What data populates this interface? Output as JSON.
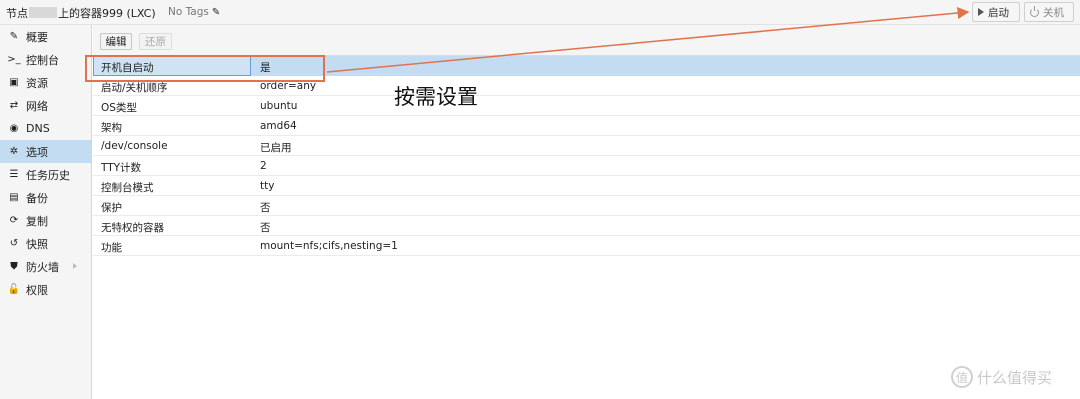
{
  "header": {
    "title_prefix": "节点",
    "title_suffix": "上的容器999 (LXC)",
    "tags_label": "No Tags",
    "start_label": "启动",
    "shutdown_label": "关机"
  },
  "sidebar": {
    "items": [
      {
        "label": "概要",
        "icon": "✎"
      },
      {
        "label": "控制台",
        "icon": ">_"
      },
      {
        "label": "资源",
        "icon": "▣"
      },
      {
        "label": "网络",
        "icon": "⇄"
      },
      {
        "label": "DNS",
        "icon": "◉"
      },
      {
        "label": "选项",
        "icon": "✲"
      },
      {
        "label": "任务历史",
        "icon": "☰"
      },
      {
        "label": "备份",
        "icon": "▤"
      },
      {
        "label": "复制",
        "icon": "⟳"
      },
      {
        "label": "快照",
        "icon": "↺"
      },
      {
        "label": "防火墙",
        "icon": "⛊"
      },
      {
        "label": "权限",
        "icon": "🔓"
      }
    ]
  },
  "toolbar": {
    "edit_label": "编辑",
    "revert_label": "还原"
  },
  "options": {
    "rows": [
      {
        "key": "开机自启动",
        "value": "是"
      },
      {
        "key": "启动/关机顺序",
        "value": "order=any"
      },
      {
        "key": "OS类型",
        "value": "ubuntu"
      },
      {
        "key": "架构",
        "value": "amd64"
      },
      {
        "key": "/dev/console",
        "value": "已启用"
      },
      {
        "key": "TTY计数",
        "value": "2"
      },
      {
        "key": "控制台模式",
        "value": "tty"
      },
      {
        "key": "保护",
        "value": "否"
      },
      {
        "key": "无特权的容器",
        "value": "否"
      },
      {
        "key": "功能",
        "value": "mount=nfs;cifs,nesting=1"
      }
    ]
  },
  "annotation": {
    "note": "按需设置",
    "color": "#e0734d"
  },
  "watermark": {
    "text": "什么值得买",
    "icon": "值"
  },
  "colors": {
    "selected_row": "#c4dcf1",
    "sidebar_bg": "#f5f5f5"
  }
}
